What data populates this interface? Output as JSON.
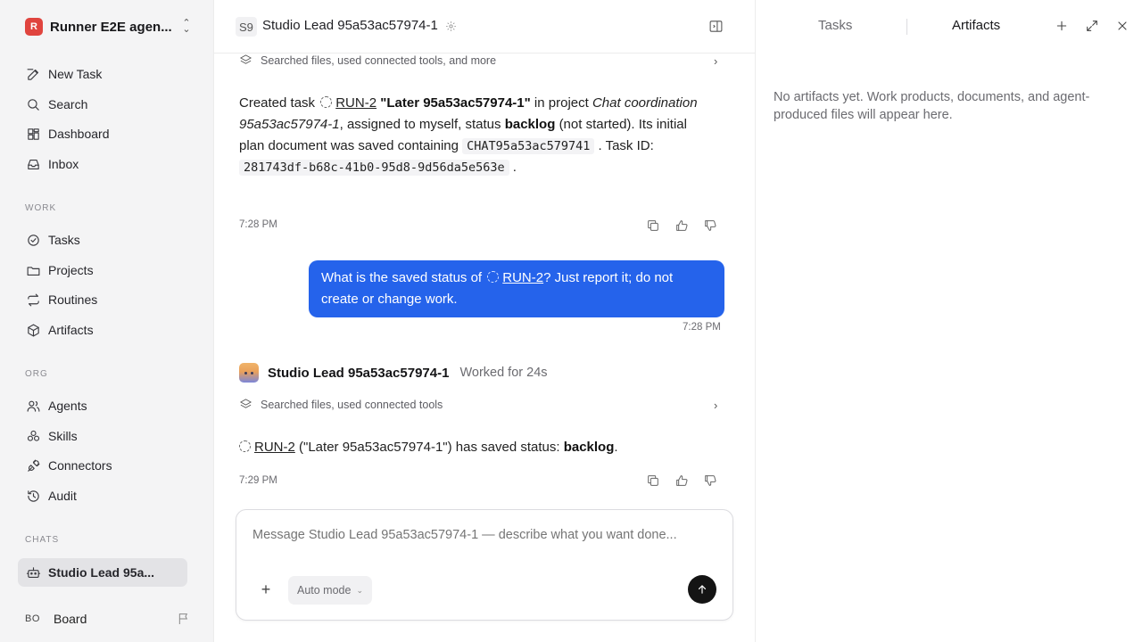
{
  "workspace": {
    "logo": "R",
    "name": "Runner E2E agen..."
  },
  "nav": {
    "primary": [
      {
        "label": "New Task",
        "icon": "edit-icon"
      },
      {
        "label": "Search",
        "icon": "search-icon"
      },
      {
        "label": "Dashboard",
        "icon": "dashboard-icon"
      },
      {
        "label": "Inbox",
        "icon": "inbox-icon"
      }
    ],
    "work_label": "WORK",
    "work": [
      {
        "label": "Tasks",
        "icon": "check-circle-icon"
      },
      {
        "label": "Projects",
        "icon": "folder-icon"
      },
      {
        "label": "Routines",
        "icon": "repeat-icon"
      },
      {
        "label": "Artifacts",
        "icon": "box-icon"
      }
    ],
    "org_label": "ORG",
    "org": [
      {
        "label": "Agents",
        "icon": "users-icon"
      },
      {
        "label": "Skills",
        "icon": "skills-icon"
      },
      {
        "label": "Connectors",
        "icon": "plug-icon"
      },
      {
        "label": "Audit",
        "icon": "history-icon"
      }
    ],
    "chats_label": "CHATS",
    "chats": [
      {
        "label": "Studio Lead 95a...",
        "icon": "bot-icon"
      }
    ]
  },
  "user": {
    "initials": "BO",
    "name": "Board"
  },
  "header": {
    "agent_badge": "S9",
    "title": "Studio Lead 95a53ac57974-1"
  },
  "conversation": {
    "tools_row_1": "Searched files, used connected tools, and more",
    "msg1": {
      "p1": "Created task",
      "task_link": "RUN-2",
      "task_title": "\"Later 95a53ac57974-1\"",
      "p2": "in project",
      "project": "Chat coordination 95a53ac57974-1",
      "p3": ", assigned to myself, status",
      "status": "backlog",
      "p4": "(not started). Its initial plan document was saved containing",
      "code1": "CHAT95a53ac579741",
      "p5": ". Task ID:",
      "code2": "281743df-b68c-41b0-95d8-9d56da5e563e",
      "p6": "."
    },
    "time1": "7:28 PM",
    "user_msg": {
      "p1": "What is the saved status of",
      "link": "RUN-2",
      "p2": "? Just report it; do not create or change work."
    },
    "time2": "7:28 PM",
    "agent_name": "Studio Lead 95a53ac57974-1",
    "worked": "Worked for 24s",
    "tools_row_2": "Searched files, used connected tools",
    "msg2": {
      "link": "RUN-2",
      "p1": "(\"Later 95a53ac57974-1\") has saved status:",
      "status": "backlog",
      "p2": "."
    },
    "time3": "7:29 PM"
  },
  "composer": {
    "placeholder": "Message Studio Lead 95a53ac57974-1 — describe what you want done...",
    "mode": "Auto mode"
  },
  "right_panel": {
    "tab_tasks": "Tasks",
    "tab_artifacts": "Artifacts",
    "empty_text": "No artifacts yet. Work products, documents, and agent-produced files will appear here."
  }
}
